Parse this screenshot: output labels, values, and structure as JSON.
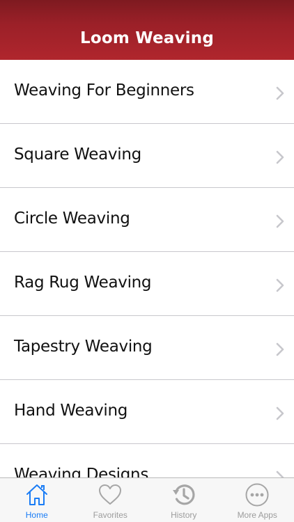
{
  "header": {
    "title": "Loom Weaving"
  },
  "list": {
    "items": [
      {
        "label": "Weaving For Beginners"
      },
      {
        "label": "Square Weaving"
      },
      {
        "label": "Circle Weaving"
      },
      {
        "label": "Rag Rug Weaving"
      },
      {
        "label": "Tapestry Weaving"
      },
      {
        "label": "Hand Weaving"
      },
      {
        "label": "Weaving Designs"
      }
    ]
  },
  "tabs": [
    {
      "label": "Home",
      "icon": "home-icon",
      "active": true
    },
    {
      "label": "Favorites",
      "icon": "heart-icon",
      "active": false
    },
    {
      "label": "History",
      "icon": "history-icon",
      "active": false
    },
    {
      "label": "More Apps",
      "icon": "more-icon",
      "active": false
    }
  ],
  "colors": {
    "nav_bar": "#9b2028",
    "active_tab": "#1a7cf5",
    "inactive_tab": "#9c9c9c"
  }
}
